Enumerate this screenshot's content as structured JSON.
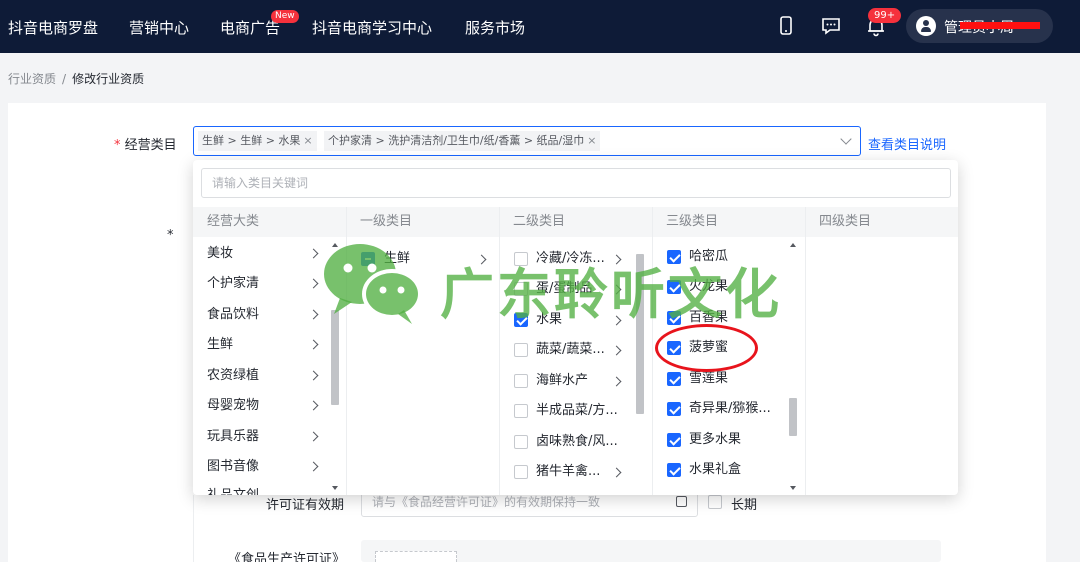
{
  "topbar": {
    "nav": [
      "抖音电商罗盘",
      "营销中心",
      "电商广告",
      "抖音电商学习中心",
      "服务市场"
    ],
    "new_badge": "New",
    "notif_badge": "99+",
    "user_name": "管理员小周",
    "icons": [
      "phone-icon",
      "message-icon",
      "bell-icon",
      "user-icon"
    ]
  },
  "breadcrumb": {
    "parent": "行业资质",
    "separator": "/",
    "current": "修改行业资质"
  },
  "form": {
    "category_label": "经营类目",
    "required_mark": "*",
    "selected_tags": [
      {
        "text": "生鲜 > 生鲜 > 水果",
        "remove": "×"
      },
      {
        "text": "个护家清 > 洗护清洁剂/卫生巾/纸/香薰 > 纸品/湿巾",
        "remove": "×"
      }
    ],
    "explain_link": "查看类目说明",
    "license_label": "许可证有效期",
    "license_placeholder": "请与《食品经营许可证》的有效期保持一致",
    "longterm_label": "长期",
    "prod_license_label": "《食品生产许可证》"
  },
  "dropdown": {
    "search_placeholder": "请输入类目关键词",
    "columns": [
      "经营大类",
      "一级类目",
      "二级类目",
      "三级类目",
      "四级类目"
    ],
    "level0": [
      "美妆",
      "个护家清",
      "食品饮料",
      "生鲜",
      "农资绿植",
      "母婴宠物",
      "玩具乐器",
      "图书音像",
      "礼品文创"
    ],
    "level1": [
      {
        "label": "生鲜",
        "state": "half"
      }
    ],
    "level2": [
      {
        "label": "冷藏/冷冻...",
        "state": "off",
        "arrow": true
      },
      {
        "label": "蛋/蛋制品",
        "state": "off",
        "arrow": true
      },
      {
        "label": "水果",
        "state": "on",
        "arrow": true
      },
      {
        "label": "蔬菜/蔬菜...",
        "state": "off",
        "arrow": true
      },
      {
        "label": "海鲜水产",
        "state": "off",
        "arrow": true
      },
      {
        "label": "半成品菜/方...",
        "state": "off",
        "arrow": false
      },
      {
        "label": "卤味熟食/风...",
        "state": "off",
        "arrow": false
      },
      {
        "label": "猪牛羊禽...",
        "state": "off",
        "arrow": true
      }
    ],
    "level3": [
      {
        "label": "哈密瓜",
        "state": "on"
      },
      {
        "label": "火龙果",
        "state": "on"
      },
      {
        "label": "百香果",
        "state": "on"
      },
      {
        "label": "菠萝蜜",
        "state": "on"
      },
      {
        "label": "雪莲果",
        "state": "on"
      },
      {
        "label": "奇异果/猕猴...",
        "state": "on"
      },
      {
        "label": "更多水果",
        "state": "on"
      },
      {
        "label": "水果礼盒",
        "state": "on"
      }
    ]
  },
  "watermark": {
    "text": "广东聆听文化",
    "icon": "wechat-icon"
  },
  "colors": {
    "nav_bg": "#0e1b37",
    "primary": "#1966ff",
    "required": "#f5313c",
    "watermark": "#52b042",
    "annotation": "#e8141c"
  }
}
